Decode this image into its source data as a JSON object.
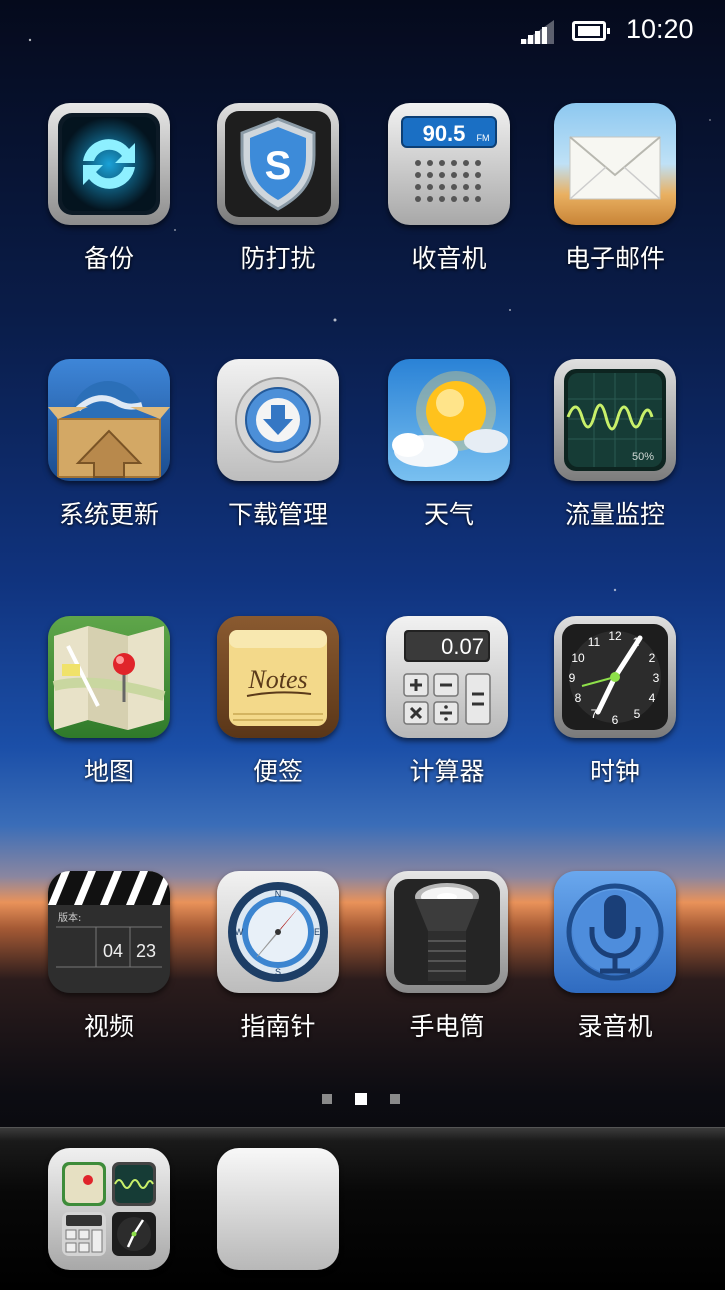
{
  "status_bar": {
    "time": "10:20",
    "signal_icon": "signal-icon",
    "battery_icon": "battery-icon"
  },
  "apps": [
    {
      "label": "备份",
      "icon": "backup-icon"
    },
    {
      "label": "防打扰",
      "icon": "shield-icon"
    },
    {
      "label": "收音机",
      "icon": "radio-icon",
      "display": "90.5",
      "unit": "FM"
    },
    {
      "label": "电子邮件",
      "icon": "mail-icon"
    },
    {
      "label": "系统更新",
      "icon": "system-update-icon"
    },
    {
      "label": "下载管理",
      "icon": "download-icon"
    },
    {
      "label": "天气",
      "icon": "weather-icon"
    },
    {
      "label": "流量监控",
      "icon": "traffic-monitor-icon",
      "percent": "50%"
    },
    {
      "label": "地图",
      "icon": "map-icon"
    },
    {
      "label": "便签",
      "icon": "notes-icon",
      "text": "Notes"
    },
    {
      "label": "计算器",
      "icon": "calculator-icon",
      "display": "0.07"
    },
    {
      "label": "时钟",
      "icon": "clock-icon"
    },
    {
      "label": "视频",
      "icon": "video-clapper-icon",
      "board_text": "版本:",
      "digits_1": "04",
      "digits_2": "23"
    },
    {
      "label": "指南针",
      "icon": "compass-icon"
    },
    {
      "label": "手电筒",
      "icon": "flashlight-icon"
    },
    {
      "label": "录音机",
      "icon": "microphone-icon"
    }
  ],
  "page_indicator": {
    "pages": 3,
    "current": 2
  },
  "dock": [
    {
      "icon": "folder-icon"
    },
    {
      "icon": "empty-slot-icon"
    }
  ]
}
